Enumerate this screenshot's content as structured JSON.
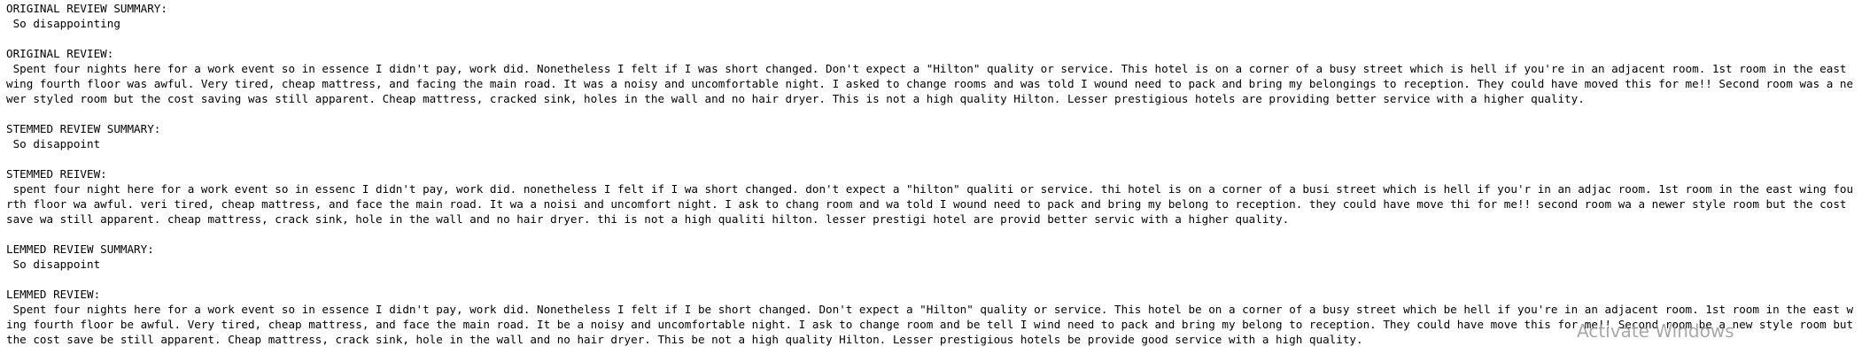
{
  "output": {
    "original_summary_label": "ORIGINAL REVIEW SUMMARY:",
    "original_summary": " So disappointing",
    "original_review_label": "ORIGINAL REVIEW:",
    "original_review": " Spent four nights here for a work event so in essence I didn't pay, work did. Nonetheless I felt if I was short changed. Don't expect a \"Hilton\" quality or service. This hotel is on a corner of a busy street which is hell if you're in an adjacent room. 1st room in the east wing fourth floor was awful. Very tired, cheap mattress, and facing the main road. It was a noisy and uncomfortable night. I asked to change rooms and was told I wound need to pack and bring my belongings to reception. They could have moved this for me!! Second room was a newer styled room but the cost saving was still apparent. Cheap mattress, cracked sink, holes in the wall and no hair dryer. This is not a high quality Hilton. Lesser prestigious hotels are providing better service with a higher quality.",
    "stemmed_summary_label": "STEMMED REVIEW SUMMARY:",
    "stemmed_summary": " So disappoint",
    "stemmed_review_label": "STEMMED REIVEW:",
    "stemmed_review": " spent four night here for a work event so in essenc I didn't pay, work did. nonetheless I felt if I wa short changed. don't expect a \"hilton\" qualiti or service. thi hotel is on a corner of a busi street which is hell if you'r in an adjac room. 1st room in the east wing fourth floor wa awful. veri tired, cheap mattress, and face the main road. It wa a noisi and uncomfort night. I ask to chang room and wa told I wound need to pack and bring my belong to reception. they could have move thi for me!! second room wa a newer style room but the cost save wa still apparent. cheap mattress, crack sink, hole in the wall and no hair dryer. thi is not a high qualiti hilton. lesser prestigi hotel are provid better servic with a higher quality.",
    "lemmed_summary_label": "LEMMED REVIEW SUMMARY:",
    "lemmed_summary": " So disappoint",
    "lemmed_review_label": "LEMMED REVIEW:",
    "lemmed_review": " Spent four nights here for a work event so in essence I didn't pay, work did. Nonetheless I felt if I be short changed. Don't expect a \"Hilton\" quality or service. This hotel be on a corner of a busy street which be hell if you're in an adjacent room. 1st room in the east wing fourth floor be awful. Very tired, cheap mattress, and face the main road. It be a noisy and uncomfortable night. I ask to change room and be tell I wind need to pack and bring my belong to reception. They could have move this for me!! Second room be a new style room but the cost save be still apparent. Cheap mattress, crack sink, hole in the wall and no hair dryer. This be not a high quality Hilton. Lesser prestigious hotels be provide good service with a high quality."
  },
  "overlay": {
    "watermark": "Activate Windows"
  }
}
